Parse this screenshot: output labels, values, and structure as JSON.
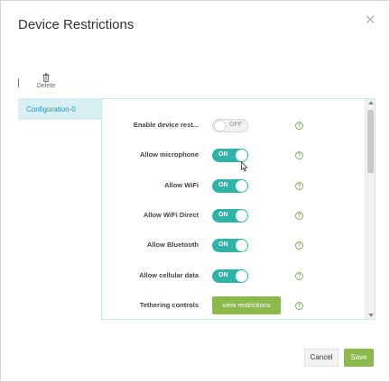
{
  "dialog": {
    "title": "Device Restrictions",
    "close_icon": "close-icon"
  },
  "toolbar": {
    "delete_label": "Delete",
    "delete_icon": "trash-icon"
  },
  "configurations": [
    {
      "label": "Configuration-0",
      "selected": true
    }
  ],
  "settings": [
    {
      "label": "Enable device rest...",
      "control": "toggle",
      "state": "OFF"
    },
    {
      "label": "Allow microphone",
      "control": "toggle",
      "state": "ON"
    },
    {
      "label": "Allow WiFi",
      "control": "toggle",
      "state": "ON"
    },
    {
      "label": "Allow WiFi Direct",
      "control": "toggle",
      "state": "ON"
    },
    {
      "label": "Allow Bluetooth",
      "control": "toggle",
      "state": "ON"
    },
    {
      "label": "Allow cellular data",
      "control": "toggle",
      "state": "ON"
    },
    {
      "label": "Tethering controls",
      "control": "button",
      "button_label": "view restrictions"
    }
  ],
  "help_symbol": "?",
  "footer": {
    "cancel_label": "Cancel",
    "save_label": "Save"
  },
  "colors": {
    "toggle_on": "#2fb3a6",
    "primary_button": "#8bb94b",
    "selected_item_bg": "#d8f0f3",
    "selected_item_text": "#2b8fb0"
  }
}
